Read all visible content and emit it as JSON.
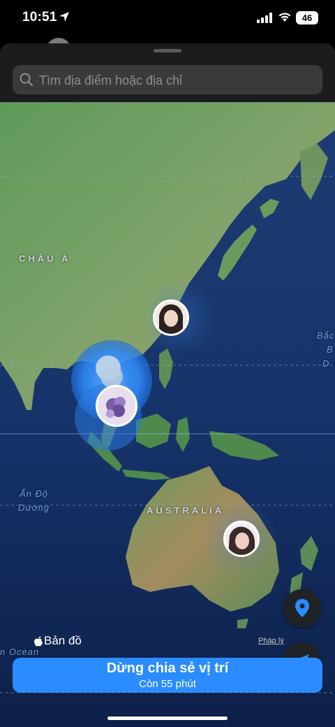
{
  "status": {
    "time": "10:51",
    "battery": "46"
  },
  "search": {
    "placeholder": "Tìm địa điểm hoặc địa chỉ"
  },
  "map": {
    "labels": {
      "asia": "CHÂU Á",
      "australia": "AUSTRALIA"
    },
    "oceans": {
      "indian_line1": "Ấn Độ",
      "indian_line2": "Dương",
      "pacific_line1": "Bắc",
      "pacific_line2": "B",
      "pacific_line3": "D",
      "southern": "n Ocean"
    }
  },
  "brand": {
    "label": "Bản đồ"
  },
  "legal": {
    "label": "Pháp lý"
  },
  "share": {
    "title": "Dừng chia sẻ vị trí",
    "subtitle": "Còn 55 phút"
  },
  "colors": {
    "accent": "#2a8cff",
    "sheet": "#1c1c1e",
    "search_bg": "#3a3a3c"
  }
}
